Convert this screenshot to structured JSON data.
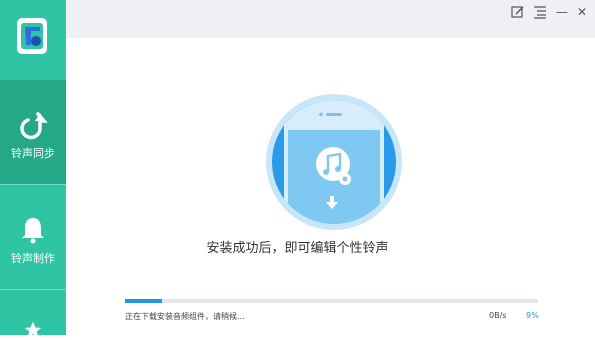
{
  "sidebar": {
    "items": [
      {
        "label": "铃声同步",
        "icon": "upload-arrow-icon"
      },
      {
        "label": "铃声制作",
        "icon": "bell-icon"
      },
      {
        "label": "",
        "icon": "star-icon"
      }
    ]
  },
  "titlebar": {
    "icons": [
      "feedback-icon",
      "menu-icon",
      "minimize-icon",
      "close-icon"
    ],
    "minimize_glyph": "—",
    "close_glyph": "✕"
  },
  "main": {
    "message": "安装成功后，即可编辑个性铃声",
    "status": "正在下载安装音频组件，请稍候...",
    "speed": "0B/s",
    "percent": "9%",
    "progress_fraction": 0.09
  },
  "colors": {
    "sidebar": "#2fc4a3",
    "sidebar_active": "#24a888",
    "accent": "#2196e6",
    "circle_light": "#c9e6f8",
    "phone_body": "#7ec8f2"
  }
}
